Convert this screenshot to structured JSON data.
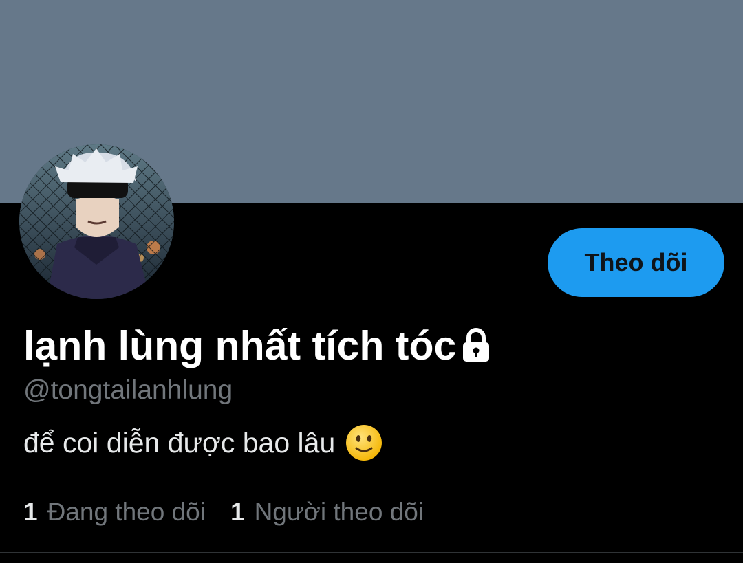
{
  "profile": {
    "display_name": "lạnh lùng nhất tích tóc",
    "handle": "@tongtailanhlung",
    "bio": "để coi diễn được bao lâu",
    "protected_icon": "lock-icon",
    "bio_emoji_icon": "slightly-smiling-face-icon"
  },
  "actions": {
    "follow_label": "Theo dõi"
  },
  "stats": {
    "following_count": "1",
    "following_label": "Đang theo dõi",
    "followers_count": "1",
    "followers_label": "Người theo dõi"
  },
  "colors": {
    "banner": "#66788a",
    "background": "#000000",
    "accent": "#1d9bf0",
    "secondary_text": "#71767b"
  }
}
